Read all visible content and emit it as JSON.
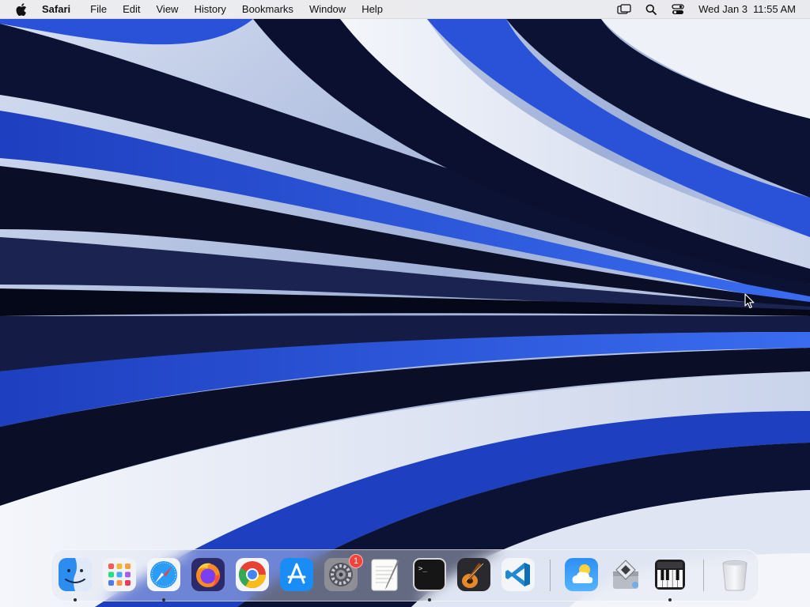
{
  "menubar": {
    "app_name": "Safari",
    "items": [
      "File",
      "Edit",
      "View",
      "History",
      "Bookmarks",
      "Window",
      "Help"
    ],
    "clock": {
      "date": "Wed Jan 3",
      "time": "11:55 AM"
    },
    "status_icons": [
      "screen-mirroring-icon",
      "search-icon",
      "control-center-icon"
    ]
  },
  "dock": {
    "apps": [
      {
        "name": "Finder",
        "icon": "finder-icon",
        "running": true
      },
      {
        "name": "Launchpad",
        "icon": "launchpad-icon",
        "running": false
      },
      {
        "name": "Safari",
        "icon": "safari-icon",
        "running": true
      },
      {
        "name": "Firefox",
        "icon": "firefox-icon",
        "running": false
      },
      {
        "name": "Google Chrome",
        "icon": "chrome-icon",
        "running": false
      },
      {
        "name": "App Store",
        "icon": "app-store-icon",
        "running": false
      },
      {
        "name": "System Settings",
        "icon": "system-settings-icon",
        "running": false,
        "badge": "1"
      },
      {
        "name": "TextEdit",
        "icon": "textedit-icon",
        "running": false
      },
      {
        "name": "Terminal",
        "icon": "terminal-icon",
        "running": true
      },
      {
        "name": "GarageBand",
        "icon": "garageband-icon",
        "running": false
      },
      {
        "name": "Visual Studio Code",
        "icon": "vscode-icon",
        "running": false
      },
      {
        "name": "Weather",
        "icon": "weather-icon",
        "running": false
      },
      {
        "name": "Boot Camp Assistant",
        "icon": "bootcamp-icon",
        "running": false
      },
      {
        "name": "Piano",
        "icon": "piano-icon",
        "running": true
      },
      {
        "name": "Trash",
        "icon": "trash-icon",
        "running": false
      }
    ]
  },
  "colors": {
    "menubar_bg": "#ececee",
    "badge": "#f2423a",
    "wallpaper_dark": "#0b0f2a",
    "wallpaper_blue": "#2a52d8"
  }
}
